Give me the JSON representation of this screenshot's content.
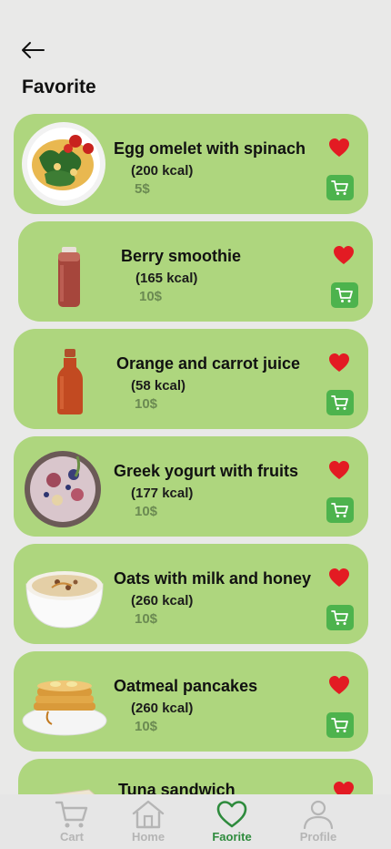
{
  "header": {
    "title": "Favorite"
  },
  "items": [
    {
      "name": "Egg omelet with spinach",
      "kcal": "(200 kcal)",
      "price": "5$"
    },
    {
      "name": "Berry smoothie",
      "kcal": "(165 kcal)",
      "price": "10$"
    },
    {
      "name": "Orange and carrot juice",
      "kcal": "(58 kcal)",
      "price": "10$"
    },
    {
      "name": "Greek yogurt with fruits",
      "kcal": "(177 kcal)",
      "price": "10$"
    },
    {
      "name": "Oats with milk and honey",
      "kcal": "(260 kcal)",
      "price": "10$"
    },
    {
      "name": "Oatmeal pancakes",
      "kcal": "(260 kcal)",
      "price": "10$"
    },
    {
      "name": "Tuna sandwich"
    }
  ],
  "tabs": [
    {
      "label": "Cart",
      "icon": "cart-icon"
    },
    {
      "label": "Home",
      "icon": "home-icon"
    },
    {
      "label": "Faorite",
      "icon": "heart-icon",
      "active": true
    },
    {
      "label": "Profile",
      "icon": "profile-icon"
    }
  ],
  "colors": {
    "background": "#e9e9e8",
    "card": "#aed67e",
    "heart": "#e31b23",
    "cart_button": "#4db34d",
    "active_tab": "#2e8b3d",
    "inactive_tab": "#b5b5b5"
  }
}
